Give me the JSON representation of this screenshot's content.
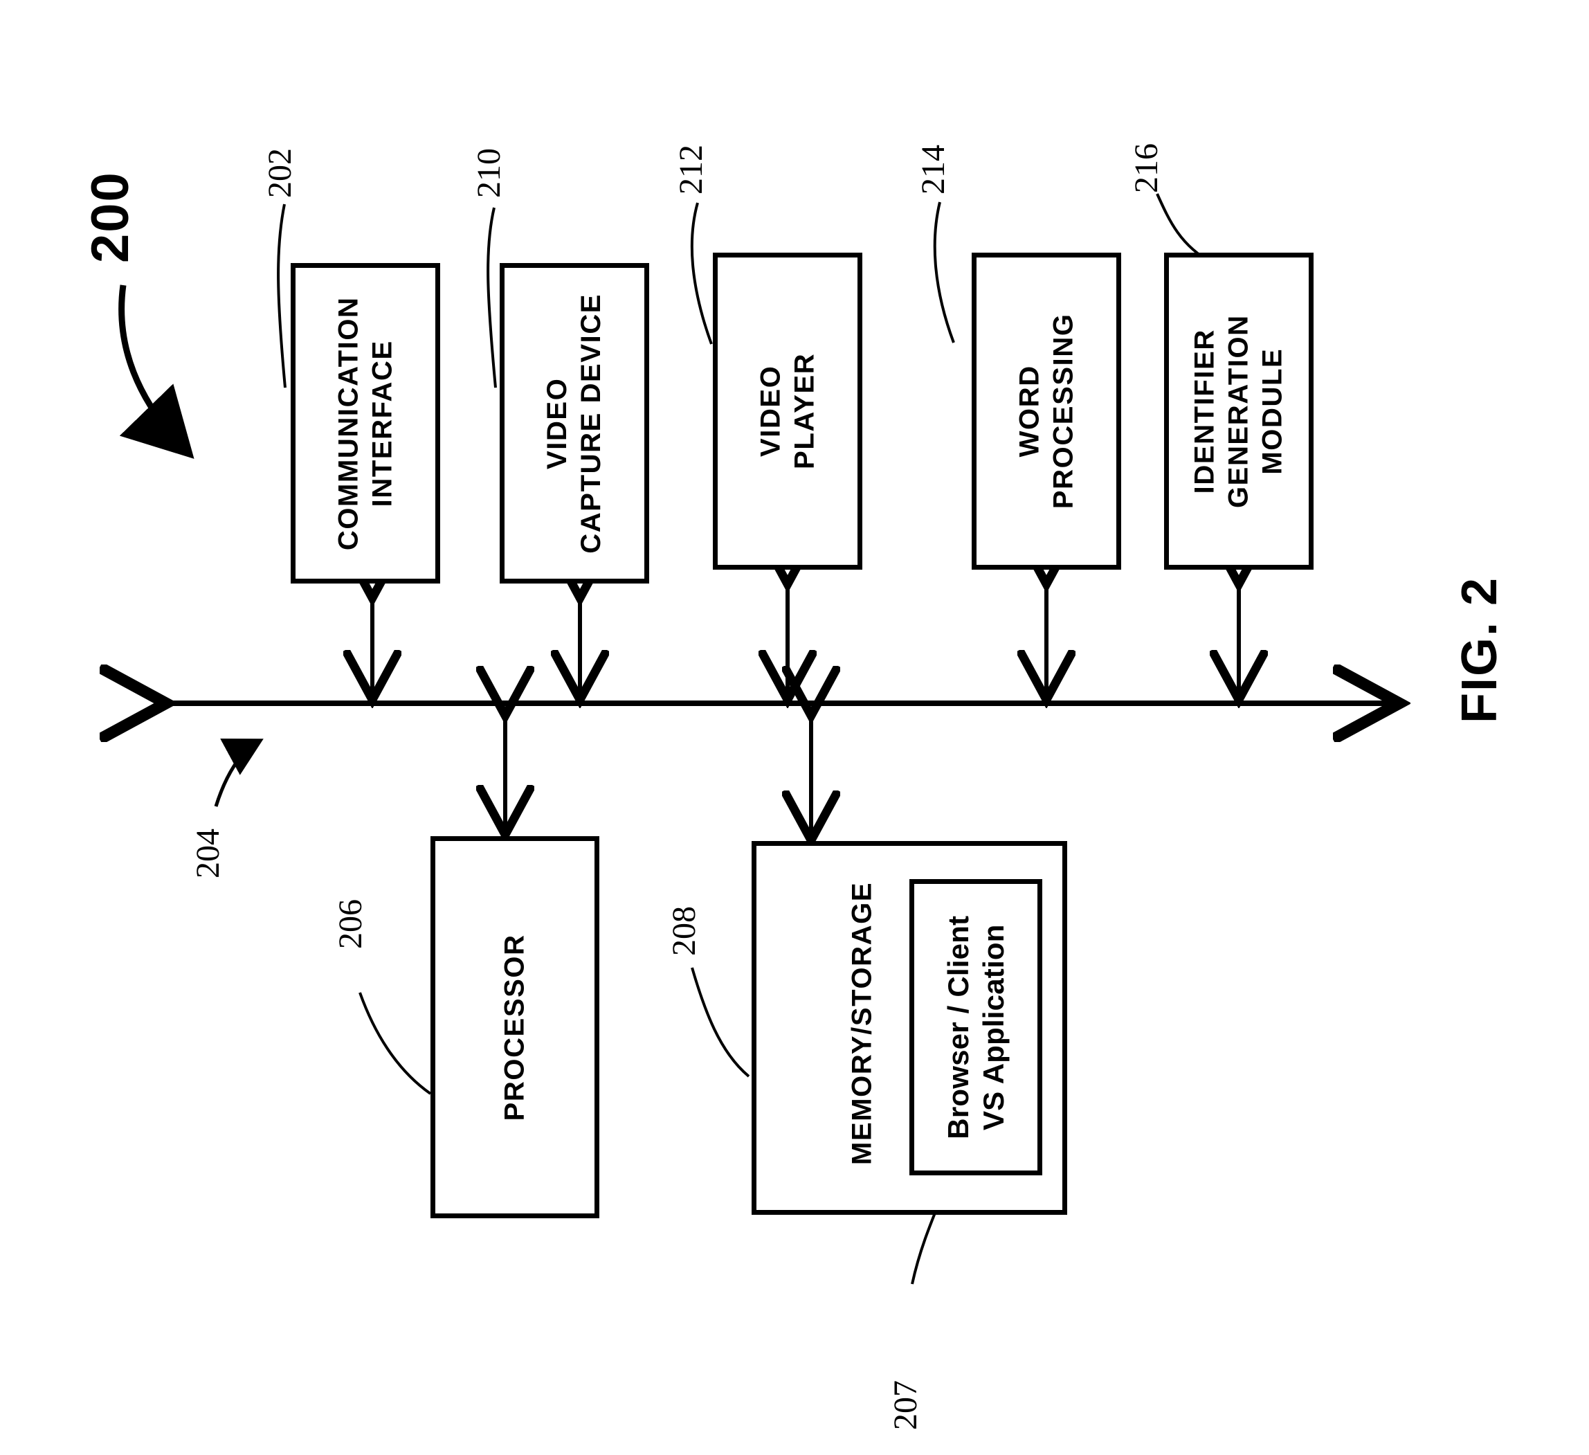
{
  "figure": {
    "title": "FIG. 2",
    "system_ref": "200",
    "bus_ref": "204"
  },
  "blocks": [
    {
      "id": "communication-interface",
      "label": "COMMUNICATION\nINTERFACE",
      "ref": "202"
    },
    {
      "id": "video-capture-device",
      "label": "VIDEO\nCAPTURE DEVICE",
      "ref": "210"
    },
    {
      "id": "video-player",
      "label": "VIDEO\nPLAYER",
      "ref": "212"
    },
    {
      "id": "word-processing",
      "label": "WORD\nPROCESSING",
      "ref": "214"
    },
    {
      "id": "identifier-generation-module",
      "label": "IDENTIFIER\nGENERATION\nMODULE",
      "ref": "216"
    },
    {
      "id": "processor",
      "label": "PROCESSOR",
      "ref": "206"
    },
    {
      "id": "memory-storage",
      "label": "MEMORY/STORAGE",
      "ref": "208"
    },
    {
      "id": "browser-client-vs-application",
      "label": "Browser / Client\nVS Application",
      "ref": "207"
    }
  ],
  "colors": {
    "stroke": "#000000",
    "background": "#ffffff"
  }
}
